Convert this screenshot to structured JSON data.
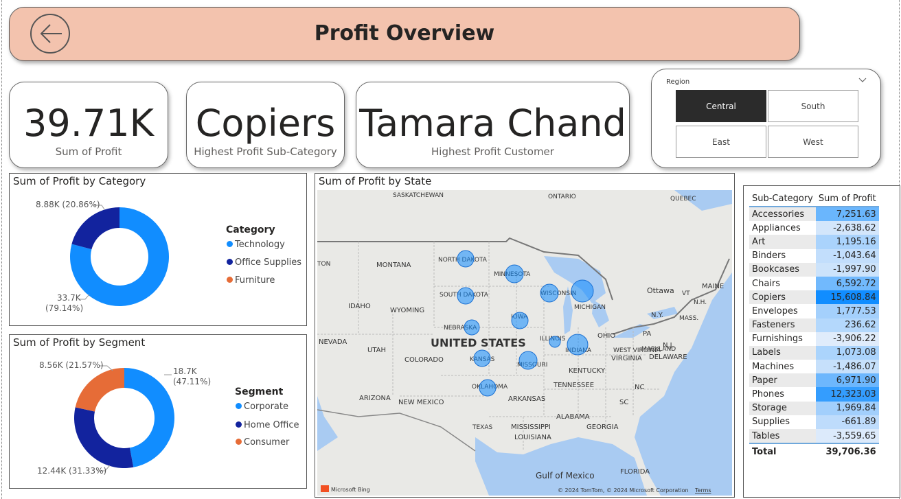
{
  "header": {
    "title": "Profit Overview",
    "back_icon": "back-arrow-icon"
  },
  "cards": [
    {
      "value": "39.71K",
      "label": "Sum of Profit"
    },
    {
      "value": "Copiers",
      "label": "Highest Profit Sub-Category"
    },
    {
      "value": "Tamara Chand",
      "label": "Highest Profit Customer"
    }
  ],
  "slicer": {
    "title": "Region",
    "options": [
      "Central",
      "South",
      "East",
      "West"
    ],
    "selected": "Central"
  },
  "category_chart": {
    "title": "Sum of Profit by Category",
    "legend_title": "Category",
    "legend": [
      "Technology",
      "Office Supplies",
      "Furniture"
    ],
    "label_office": "8.88K (20.86%)",
    "label_tech_1": "33.7K",
    "label_tech_2": "(79.14%)"
  },
  "segment_chart": {
    "title": "Sum of Profit by Segment",
    "legend_title": "Segment",
    "legend": [
      "Corporate",
      "Home Office",
      "Consumer"
    ],
    "label_consumer": "8.56K (21.57%)",
    "label_corp_1": "18.7K",
    "label_corp_2": "(47.11%)",
    "label_home": "12.44K (31.33%)"
  },
  "map": {
    "title": "Sum of Profit by State",
    "country": "UNITED STATES",
    "labels": [
      "SASKATCHEWAN",
      "ONTARIO",
      "QUEBEC",
      "MONTANA",
      "NORTH DAKOTA",
      "MINNESOTA",
      "SOUTH DAKOTA",
      "WISCONSIN",
      "MICHIGAN",
      "Ottawa",
      "IDAHO",
      "WYOMING",
      "NEBRASKA",
      "IOWA",
      "NEVADA",
      "UTAH",
      "COLORADO",
      "KANSAS",
      "ILLINOIS",
      "INDIANA",
      "OHIO",
      "MISSOURI",
      "KENTUCKY",
      "PA",
      "VIRGINIA",
      "WEST VIRGINIA",
      "ARIZONA",
      "NEW MEXICO",
      "OKLAHOMA",
      "ARKANSAS",
      "TENNESSEE",
      "TEXAS",
      "ALABAMA",
      "MISSISSIPPI",
      "GEORGIA",
      "LOUISIANA",
      "FLORIDA",
      "NC",
      "SC",
      "MAINE",
      "VT",
      "N.H.",
      "MASS.",
      "N.Y.",
      "N.J.",
      "DELAWARE",
      "MARYLAND",
      "TON",
      "Gulf of Mexico"
    ],
    "attribution": "© 2024 TomTom, © 2024 Microsoft Corporation",
    "terms": "Terms",
    "bing": "Microsoft Bing"
  },
  "chart_data": [
    {
      "type": "pie",
      "title": "Sum of Profit by Category",
      "categories": [
        "Technology",
        "Office Supplies",
        "Furniture"
      ],
      "values": [
        33.7,
        8.88,
        0
      ],
      "unit": "K",
      "percent": [
        79.14,
        20.86,
        0
      ],
      "colors": [
        "#118dff",
        "#12239e",
        "#e66c37"
      ]
    },
    {
      "type": "pie",
      "title": "Sum of Profit by Segment",
      "categories": [
        "Corporate",
        "Home Office",
        "Consumer"
      ],
      "values": [
        18.7,
        12.44,
        8.56
      ],
      "unit": "K",
      "percent": [
        47.11,
        31.33,
        21.57
      ],
      "colors": [
        "#118dff",
        "#12239e",
        "#e66c37"
      ]
    },
    {
      "type": "table",
      "columns": [
        "Sub-Category",
        "Sum of Profit"
      ],
      "rows": [
        [
          "Accessories",
          "7,251.63"
        ],
        [
          "Appliances",
          "-2,638.62"
        ],
        [
          "Art",
          "1,195.16"
        ],
        [
          "Binders",
          "-1,043.64"
        ],
        [
          "Bookcases",
          "-1,997.90"
        ],
        [
          "Chairs",
          "6,592.72"
        ],
        [
          "Copiers",
          "15,608.84"
        ],
        [
          "Envelopes",
          "1,777.53"
        ],
        [
          "Fasteners",
          "236.62"
        ],
        [
          "Furnishings",
          "-3,906.22"
        ],
        [
          "Labels",
          "1,073.08"
        ],
        [
          "Machines",
          "-1,486.07"
        ],
        [
          "Paper",
          "6,971.90"
        ],
        [
          "Phones",
          "12,323.03"
        ],
        [
          "Storage",
          "1,969.84"
        ],
        [
          "Supplies",
          "-661.89"
        ],
        [
          "Tables",
          "-3,559.65"
        ]
      ],
      "values": [
        7251.63,
        -2638.62,
        1195.16,
        -1043.64,
        -1997.9,
        6592.72,
        15608.84,
        1777.53,
        236.62,
        -3906.22,
        1073.08,
        -1486.07,
        6971.9,
        12323.03,
        1969.84,
        -661.89,
        -3559.65
      ],
      "total_label": "Total",
      "total": "39,706.36"
    }
  ]
}
